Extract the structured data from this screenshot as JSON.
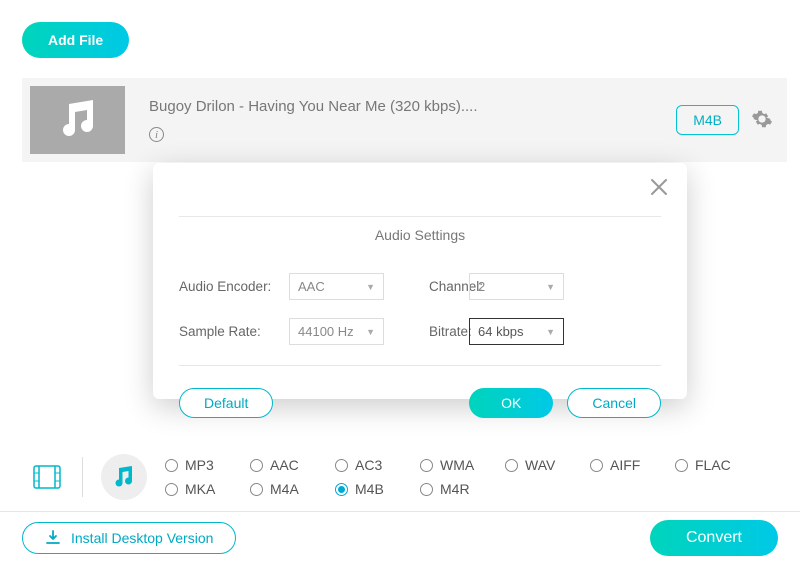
{
  "header": {
    "add_file": "Add File"
  },
  "file": {
    "title": "Bugoy Drilon - Having You Near Me (320 kbps)....",
    "badge": "M4B"
  },
  "modal": {
    "title": "Audio Settings",
    "encoder_label": "Audio Encoder:",
    "encoder_value": "AAC",
    "channel_label": "Channel:",
    "channel_value": "2",
    "sample_label": "Sample Rate:",
    "sample_value": "44100 Hz",
    "bitrate_label": "Bitrate:",
    "bitrate_value": "64 kbps",
    "default": "Default",
    "ok": "OK",
    "cancel": "Cancel"
  },
  "formats": {
    "row1": [
      "MP3",
      "AAC",
      "AC3",
      "WMA",
      "WAV",
      "AIFF",
      "FLAC"
    ],
    "row2": [
      "MKA",
      "M4A",
      "M4B",
      "M4R"
    ],
    "selected": "M4B"
  },
  "footer": {
    "install": "Install Desktop Version",
    "convert": "Convert"
  }
}
